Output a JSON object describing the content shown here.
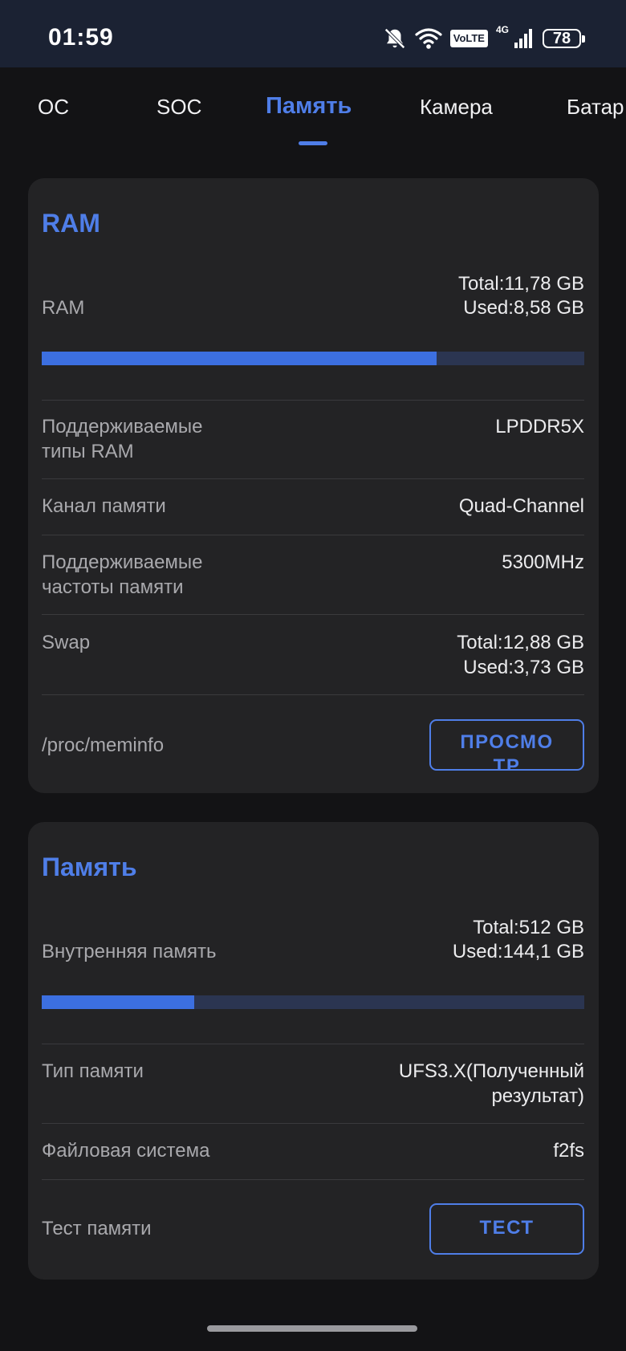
{
  "status_bar": {
    "time": "01:59",
    "volte": "VoLTE",
    "network": "4G",
    "battery": "78",
    "icons": [
      "bell-muted-icon",
      "wifi-icon",
      "volte-icon",
      "signal-icon",
      "battery-icon"
    ]
  },
  "tabs": [
    {
      "label": "ОС",
      "active": false
    },
    {
      "label": "SOC",
      "active": false
    },
    {
      "label": "Память",
      "active": true
    },
    {
      "label": "Камера",
      "active": false
    },
    {
      "label": "Батар",
      "active": false
    }
  ],
  "ram_card": {
    "title": "RAM",
    "ram_label": "RAM",
    "ram_total": "Total:11,78 GB",
    "ram_used": "Used:8,58 GB",
    "ram_used_fraction": 0.728,
    "types_label_1": "Поддерживаемые",
    "types_label_2": "типы RAM",
    "types_value": "LPDDR5X",
    "channel_label": "Канал памяти",
    "channel_value": "Quad-Channel",
    "freq_label_1": "Поддерживаемые",
    "freq_label_2": "частоты памяти",
    "freq_value": "5300MHz",
    "swap_label": "Swap",
    "swap_total": "Total:12,88 GB",
    "swap_used": "Used:3,73 GB",
    "meminfo_label": "/proc/meminfo",
    "view_button": "ПРОСМОТР"
  },
  "storage_card": {
    "title": "Память",
    "internal_label": "Внутренняя память",
    "internal_total": "Total:512 GB",
    "internal_used": "Used:144,1 GB",
    "internal_used_fraction": 0.281,
    "type_label": "Тип памяти",
    "type_value_1": "UFS3.X(Полученный",
    "type_value_2": "результат)",
    "fs_label": "Файловая система",
    "fs_value": "f2fs",
    "test_label": "Тест памяти",
    "test_button": "ТЕСТ"
  },
  "colors": {
    "accent": "#4f7ee8",
    "bar_fill": "#3c6fe0",
    "bar_track": "#2b3551",
    "card_bg": "#232325",
    "page_bg": "#131315",
    "status_bg": "#1b2233"
  }
}
